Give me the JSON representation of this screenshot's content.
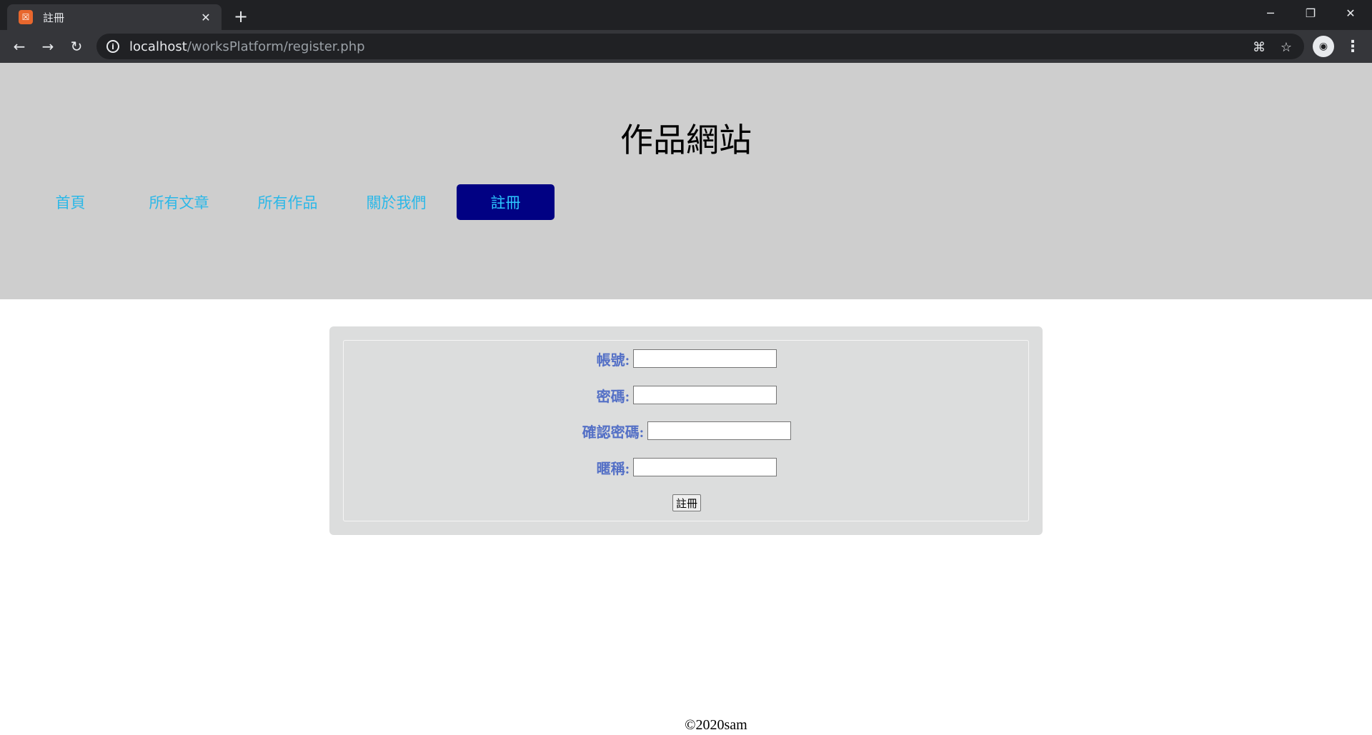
{
  "browser": {
    "tab_title": "註冊",
    "tab_favicon": "xampp-icon",
    "url_host": "localhost",
    "url_path": "/worksPlatform/register.php"
  },
  "site": {
    "title": "作品網站",
    "nav": [
      {
        "label": "首頁",
        "active": false
      },
      {
        "label": "所有文章",
        "active": false
      },
      {
        "label": "所有作品",
        "active": false
      },
      {
        "label": "關於我們",
        "active": false
      },
      {
        "label": "註冊",
        "active": true
      }
    ],
    "colors": {
      "header_bg": "#cecece",
      "nav_link": "#2bb8e8",
      "nav_active_bg": "#010183",
      "form_label": "#5470c6",
      "form_bg": "#dcdddd"
    }
  },
  "form": {
    "account_label": "帳號:",
    "account_value": "",
    "password_label": "密碼:",
    "password_value": "",
    "confirm_label": "確認密碼:",
    "confirm_value": "",
    "nickname_label": "暱稱:",
    "nickname_value": "",
    "submit_label": "註冊"
  },
  "footer": {
    "text": "©2020sam"
  }
}
